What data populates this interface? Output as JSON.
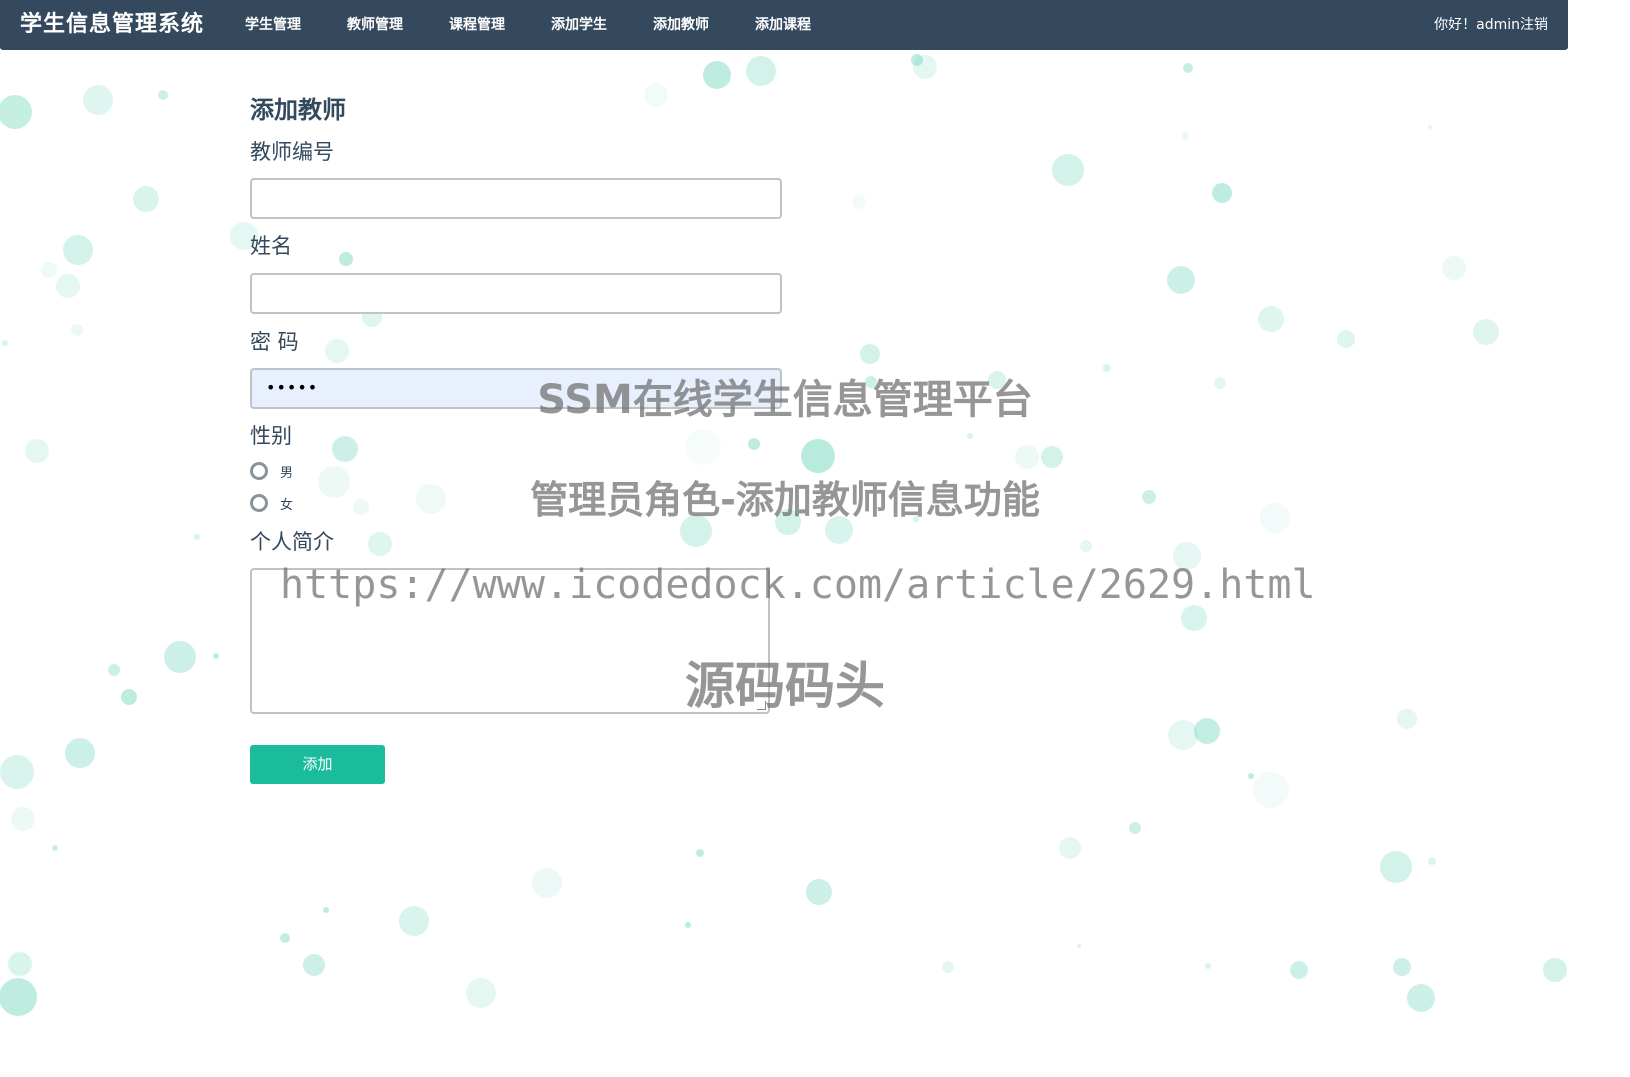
{
  "navbar": {
    "brand": "学生信息管理系统",
    "items": [
      {
        "label": "学生管理"
      },
      {
        "label": "教师管理"
      },
      {
        "label": "课程管理"
      },
      {
        "label": "添加学生"
      },
      {
        "label": "添加教师"
      },
      {
        "label": "添加课程"
      }
    ],
    "greeting": "你好！",
    "username": "admin",
    "logout": "注销",
    "bg_color": "#34495e"
  },
  "form": {
    "title": "添加教师",
    "teacher_id_label": "教师编号",
    "teacher_id_value": "",
    "name_label": "姓名",
    "name_value": "",
    "password_label": "密 码",
    "password_masked": "•••••",
    "gender_label": "性别",
    "gender_options": [
      "男",
      "女"
    ],
    "bio_label": "个人简介",
    "bio_value": "",
    "submit_label": "添加",
    "accent_color": "#1abc9c"
  },
  "watermark": {
    "line1": "SSM在线学生信息管理平台",
    "line2": "管理员角色-添加教师信息功能",
    "line3": "https://www.icodedock.com/article/2629.html",
    "line4": "源码码头"
  }
}
